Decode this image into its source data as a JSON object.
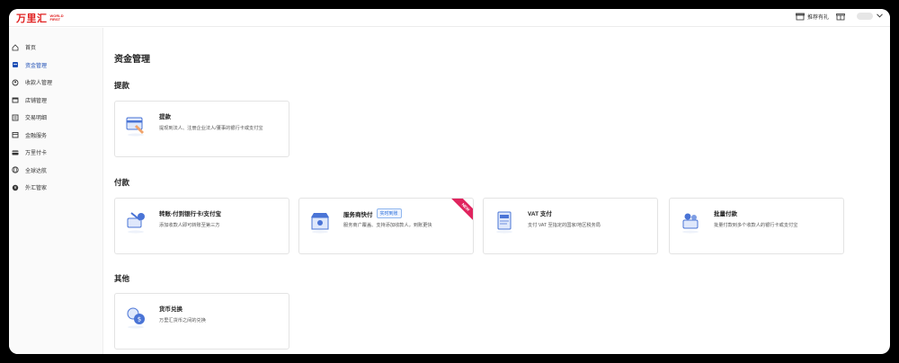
{
  "header": {
    "logo_text": "万里汇",
    "logo_sub": "WORLD FIRST",
    "referral_label": "推荐有礼"
  },
  "sidebar": {
    "items": [
      {
        "label": "首页",
        "icon": "home-icon"
      },
      {
        "label": "资金管理",
        "icon": "wallet-icon",
        "active": true
      },
      {
        "label": "收款人管理",
        "icon": "payee-icon"
      },
      {
        "label": "店铺管理",
        "icon": "store-icon"
      },
      {
        "label": "交易明细",
        "icon": "transactions-icon"
      },
      {
        "label": "金融服务",
        "icon": "finance-icon"
      },
      {
        "label": "万里付卡",
        "icon": "card-icon"
      },
      {
        "label": "全球达航",
        "icon": "globe-icon"
      },
      {
        "label": "外汇管家",
        "icon": "fx-icon"
      }
    ]
  },
  "main": {
    "title": "资金管理",
    "sections": {
      "withdraw": {
        "title": "提款"
      },
      "pay": {
        "title": "付款"
      },
      "other": {
        "title": "其他"
      }
    },
    "cards": {
      "withdraw": {
        "title": "提款",
        "desc": "提现到法人、注册企业法人/董事的银行卡或支付宝"
      },
      "transfer": {
        "title": "转账-付到银行卡/支付宝",
        "desc": "添加收款人即可转账至第三方"
      },
      "service_pay": {
        "title": "服务商快付",
        "badge": "实时到账",
        "ribbon": "NEW",
        "desc": "服务商广覆盖、支持添加收款人，到账更快"
      },
      "vat": {
        "title": "VAT 支付",
        "desc": "支付 VAT 至指定的国家/地区税务局"
      },
      "batch": {
        "title": "批量付款",
        "desc": "批量付款到多个收款人的银行卡或支付宝"
      },
      "fx": {
        "title": "货币兑换",
        "desc": "万里汇货币之间的兑换"
      }
    }
  },
  "colors": {
    "brand": "#e02020",
    "active_nav": "#1f4fb5",
    "badge_blue": "#2a6fdb",
    "ribbon": "#e0245e"
  }
}
